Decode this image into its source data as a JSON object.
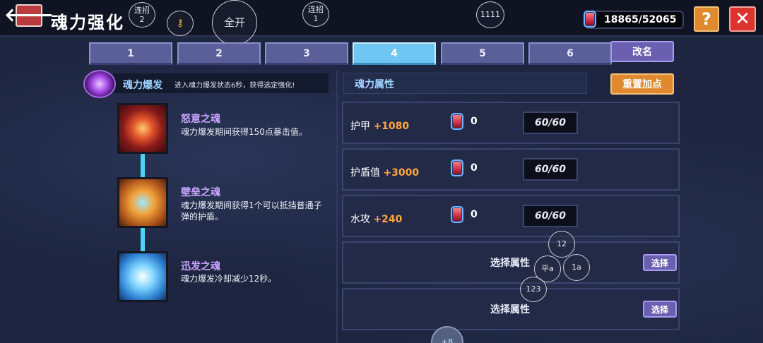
{
  "header": {
    "back_icon": "arrow-left-icon",
    "title": "魂力强化",
    "currency": "18865/52065",
    "help_label": "?",
    "close_label": "✕"
  },
  "overlay_labels": {
    "combo2": "连招\n2",
    "key": "key-icon",
    "expand_all": "全开",
    "combo1": "连招\n1",
    "num1111": "1111",
    "n12": "12",
    "ping_a": "平a",
    "n1a": "1a",
    "n123": "123"
  },
  "tabs": [
    "1",
    "2",
    "3",
    "4",
    "5",
    "6"
  ],
  "active_tab": "4",
  "rename_label": "改名",
  "burst": {
    "title": "魂力爆发",
    "desc": "进入魂力爆发状态6秒，获得选定强化!"
  },
  "souls": [
    {
      "name": "怒意之魂",
      "desc": "魂力爆发期间获得150点暴击值。"
    },
    {
      "name": "壁垒之魂",
      "desc": "魂力爆发期间获得1个可以抵挡普通子弹的护盾。"
    },
    {
      "name": "迅发之魂",
      "desc": "魂力爆发冷却减少12秒。"
    }
  ],
  "attr_panel": {
    "title": "魂力属性",
    "reset_label": "重置加点",
    "rows": [
      {
        "label": "护甲",
        "bonus": "+1080",
        "count": "0",
        "value": "60/60"
      },
      {
        "label": "护盾值",
        "bonus": "+3000",
        "count": "0",
        "value": "60/60"
      },
      {
        "label": "水攻",
        "bonus": "+240",
        "count": "0",
        "value": "60/60"
      }
    ],
    "empty_rows": [
      {
        "label": "选择属性",
        "button": "选择"
      },
      {
        "label": "选择属性",
        "button": "选择"
      }
    ]
  },
  "bottom_bubble": "+8"
}
